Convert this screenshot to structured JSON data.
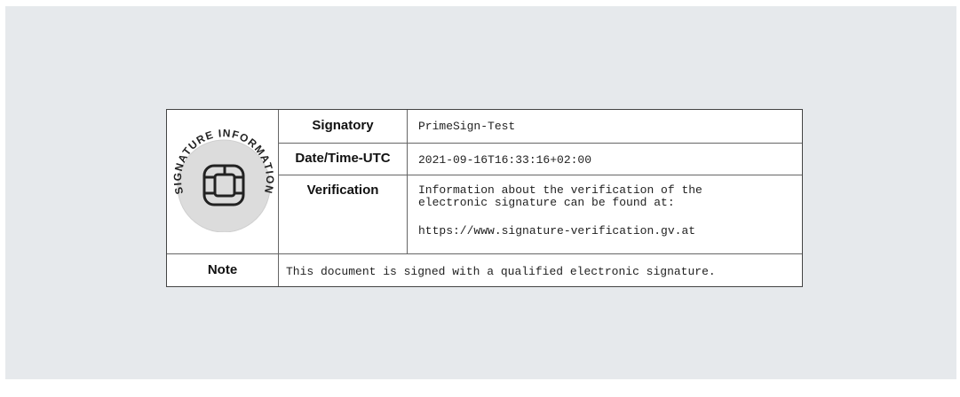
{
  "block": {
    "seal_text": "SIGNATURE INFORMATION",
    "rows": {
      "signatory": {
        "label": "Signatory",
        "value": "PrimeSign-Test"
      },
      "datetime": {
        "label": "Date/Time-UTC",
        "value": "2021-09-16T16:33:16+02:00"
      },
      "verification": {
        "label": "Verification",
        "line1": "Information about the verification of the",
        "line2": "electronic signature can be found at:",
        "url": "https://www.signature-verification.gv.at"
      },
      "note": {
        "label": "Note",
        "value": "This document is signed with a qualified electronic signature."
      }
    }
  },
  "colors": {
    "page_background": "#e6e9ec",
    "table_background": "#ffffff",
    "border": "#444444",
    "seal_fill": "#dcdcdc"
  },
  "icons": {
    "seal": "chip-seal-icon"
  }
}
